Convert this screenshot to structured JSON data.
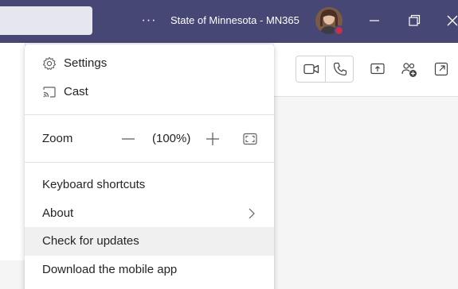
{
  "titlebar": {
    "org_name": "State of Minnesota - MN365",
    "more_options_label": "···"
  },
  "menu": {
    "settings_label": "Settings",
    "cast_label": "Cast",
    "zoom": {
      "label": "Zoom",
      "value": "(100%)"
    },
    "keyboard_shortcuts_label": "Keyboard shortcuts",
    "about_label": "About",
    "check_updates_label": "Check for updates",
    "download_mobile_label": "Download the mobile app"
  },
  "colors": {
    "titlebar": "#464775",
    "hover_row": "#f0f0f0",
    "presence_busy": "#c4314b"
  },
  "icons": {
    "settings": "gear-icon",
    "cast": "cast-icon",
    "video": "video-camera-icon",
    "audio": "phone-icon",
    "share": "share-screen-icon",
    "add_people": "add-people-icon",
    "pop_out": "pop-out-icon"
  }
}
